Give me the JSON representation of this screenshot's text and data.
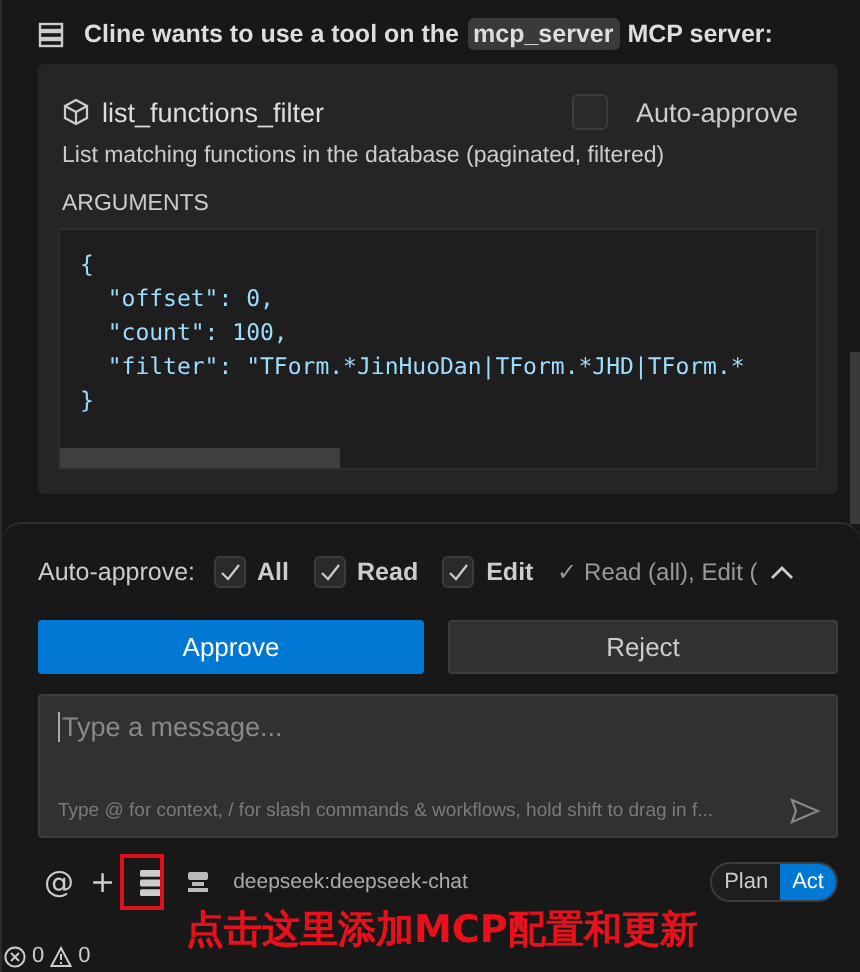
{
  "header": {
    "before": "Cline wants to use a tool on the",
    "server": "mcp_server",
    "after": "MCP server:"
  },
  "tool": {
    "name": "list_functions_filter",
    "auto_approve": {
      "label": "Auto-approve",
      "checked": false
    },
    "description": "List matching functions in the database (paginated, filtered)",
    "arguments_label": "ARGUMENTS",
    "code_lines": [
      "{",
      "  \"offset\": 0,",
      "  \"count\": 100,",
      "  \"filter\": \"TForm.*JinHuoDan|TForm.*JHD|TForm.*",
      "}"
    ]
  },
  "auto_approve_bar": {
    "label": "Auto-approve:",
    "options": [
      {
        "label": "All",
        "checked": true
      },
      {
        "label": "Read",
        "checked": true
      },
      {
        "label": "Edit",
        "checked": true
      }
    ],
    "summary": "✓ Read (all), Edit (",
    "expanded": true
  },
  "buttons": [
    {
      "label": "Approve",
      "kind": "primary"
    },
    {
      "label": "Reject",
      "kind": "secondary"
    }
  ],
  "input": {
    "placeholder": "Type a message...",
    "hint": "Type @ for context, / for slash commands & workflows, hold shift to drag in f..."
  },
  "toolbar": {
    "at": "@",
    "plus": "+",
    "model": "deepseek:deepseek-chat",
    "modes": [
      {
        "label": "Plan",
        "selected": false
      },
      {
        "label": "Act",
        "selected": true
      }
    ]
  },
  "annotation": {
    "text": "点击这里添加MCP配置和更新"
  },
  "status_bar": {
    "errors": "0",
    "warnings": "0"
  }
}
